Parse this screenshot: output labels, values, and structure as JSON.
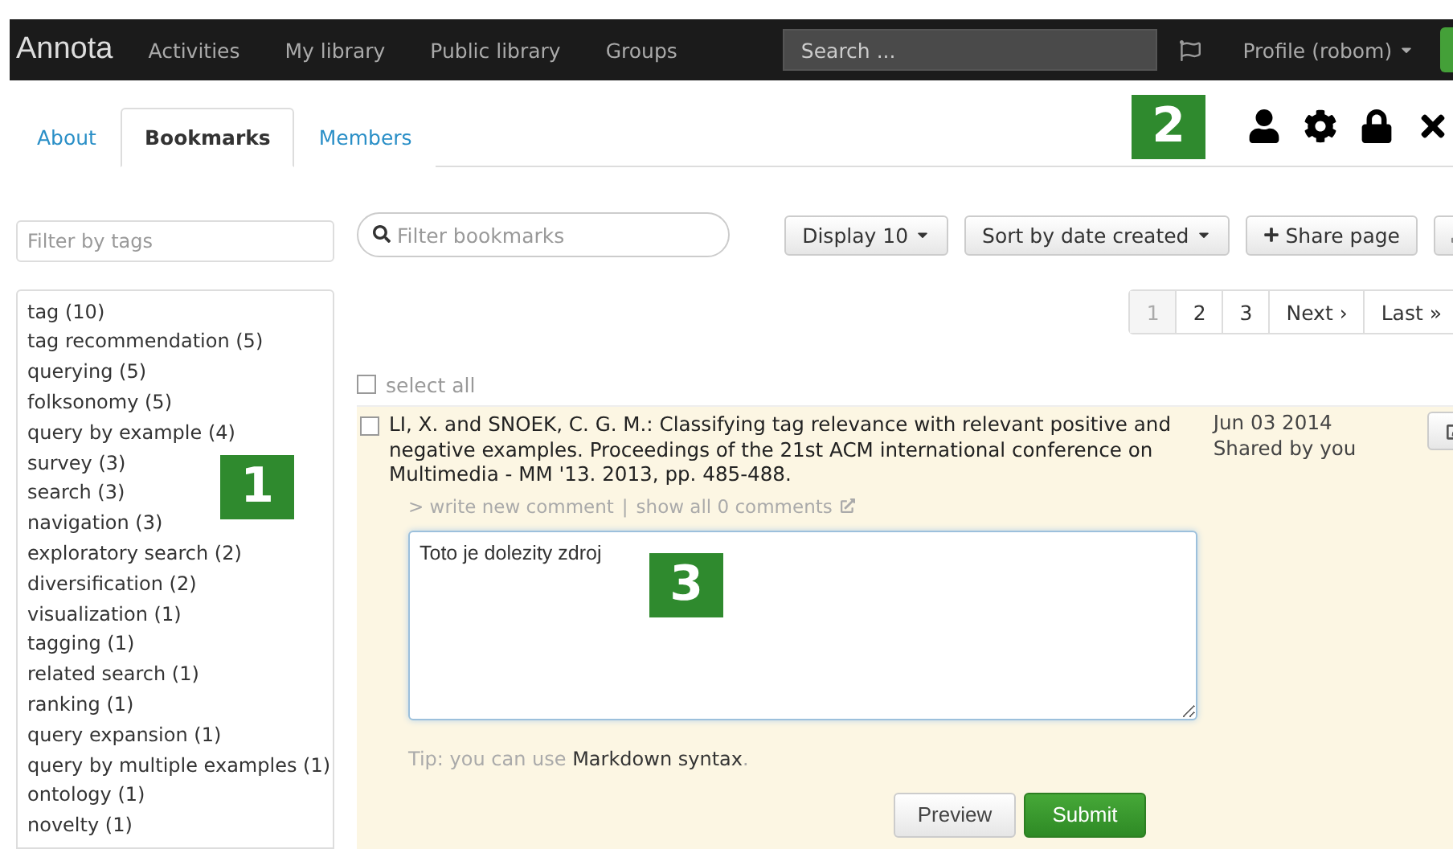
{
  "topbar": {
    "logo": "Annota",
    "nav": [
      {
        "label": "Activities"
      },
      {
        "label": "My library"
      },
      {
        "label": "Public library"
      },
      {
        "label": "Groups"
      }
    ],
    "search": {
      "placeholder": "Search ..."
    },
    "profile": "Profile (robom)"
  },
  "tabs": [
    {
      "label": "About",
      "selected": false
    },
    {
      "label": "Bookmarks",
      "selected": true
    },
    {
      "label": "Members",
      "selected": false
    }
  ],
  "callouts": [
    "1",
    "2",
    "3"
  ],
  "tag_filter": {
    "placeholder": "Filter by tags"
  },
  "tags": [
    {
      "label": "tag (10)"
    },
    {
      "label": "tag recommendation (5)"
    },
    {
      "label": "querying (5)"
    },
    {
      "label": "folksonomy (5)"
    },
    {
      "label": "query by example (4)"
    },
    {
      "label": "survey (3)"
    },
    {
      "label": "search (3)"
    },
    {
      "label": "navigation (3)"
    },
    {
      "label": "exploratory search (2)"
    },
    {
      "label": "diversification (2)"
    },
    {
      "label": "visualization (1)"
    },
    {
      "label": "tagging (1)"
    },
    {
      "label": "related search (1)"
    },
    {
      "label": "ranking (1)"
    },
    {
      "label": "query expansion (1)"
    },
    {
      "label": "query by multiple examples (1)"
    },
    {
      "label": "ontology (1)"
    },
    {
      "label": "novelty (1)"
    }
  ],
  "bookmark_filter": {
    "placeholder": "Filter bookmarks"
  },
  "toolbar": [
    {
      "label": "Display 10",
      "kind": "dropdown"
    },
    {
      "label": "Sort by date created",
      "kind": "dropdown"
    },
    {
      "label": "Share page",
      "kind": "add"
    },
    {
      "kind": "download"
    }
  ],
  "pagination": [
    {
      "label": "1",
      "selected": true
    },
    {
      "label": "2",
      "selected": false
    },
    {
      "label": "3",
      "selected": false
    },
    {
      "label": "Next ›",
      "selected": false
    },
    {
      "label": "Last »",
      "selected": false
    }
  ],
  "select_all": {
    "label": "select all",
    "checked": false
  },
  "bookmark": {
    "checked": false,
    "citation": "LI, X. and SNOEK, C. G. M.: Classifying tag relevance with relevant positive and negative examples. Proceedings of the 21st ACM international conference on Multimedia - MM '13. 2013, pp. 485-488.",
    "date": "Jun 03 2014",
    "shared": "Shared by you",
    "write_comment": "> write new comment",
    "separator": "|",
    "show_comments": "show all 0 comments",
    "comment": "Toto je dolezity zdroj",
    "tip": {
      "text": "Tip: you can use",
      "link": "Markdown syntax",
      "end": "."
    },
    "buttons": [
      {
        "label": "Preview",
        "kind": "default"
      },
      {
        "label": "Submit",
        "kind": "primary"
      }
    ]
  }
}
